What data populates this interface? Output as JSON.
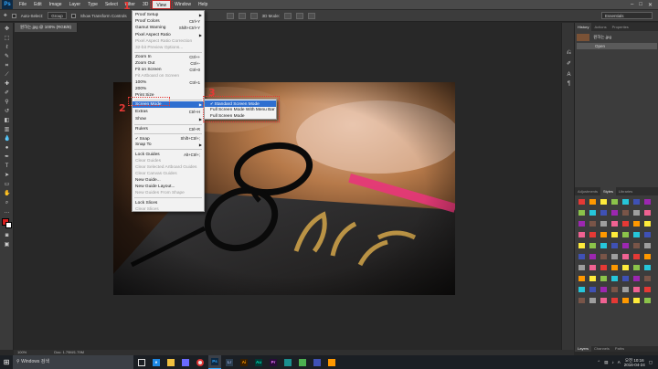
{
  "menubar": {
    "logo": "Ps",
    "items": [
      "File",
      "Edit",
      "Image",
      "Layer",
      "Type",
      "Select",
      "Filter",
      "3D",
      "View",
      "Window",
      "Help"
    ],
    "window_controls": [
      "–",
      "□",
      "✕"
    ]
  },
  "options_bar": {
    "auto_select_label": "Auto-Select:",
    "auto_select_value": "Group",
    "show_transform_label": "Show Transform Controls",
    "mode_3d": "3D Mode:",
    "workspace": "Essentials"
  },
  "document_tab": {
    "title": "원하는.jpg @ 100% (RGB/8)"
  },
  "view_menu": {
    "items": [
      {
        "label": "Proof Setup",
        "shortcut": "",
        "submenu": true,
        "disabled": false
      },
      {
        "label": "Proof Colors",
        "shortcut": "Ctrl+Y",
        "disabled": false
      },
      {
        "label": "Gamut Warning",
        "shortcut": "Shift+Ctrl+Y",
        "disabled": false
      },
      {
        "label": "Pixel Aspect Ratio",
        "shortcut": "",
        "submenu": true,
        "disabled": false
      },
      {
        "label": "Pixel Aspect Ratio Correction",
        "shortcut": "",
        "disabled": true
      },
      {
        "label": "32-bit Preview Options...",
        "shortcut": "",
        "disabled": true
      },
      {
        "label": "Zoom In",
        "shortcut": "Ctrl++",
        "disabled": false
      },
      {
        "label": "Zoom Out",
        "shortcut": "Ctrl+-",
        "disabled": false
      },
      {
        "label": "Fit on Screen",
        "shortcut": "Ctrl+0",
        "disabled": false
      },
      {
        "label": "Fit Artboard on Screen",
        "shortcut": "",
        "disabled": true
      },
      {
        "label": "100%",
        "shortcut": "Ctrl+1",
        "disabled": false
      },
      {
        "label": "200%",
        "shortcut": "",
        "disabled": false
      },
      {
        "label": "Print Size",
        "shortcut": "",
        "disabled": false
      },
      {
        "label": "Screen Mode",
        "shortcut": "",
        "submenu": true,
        "disabled": false,
        "highlighted": true
      },
      {
        "label": "Extras",
        "shortcut": "Ctrl+H",
        "disabled": false
      },
      {
        "label": "Show",
        "shortcut": "",
        "submenu": true,
        "disabled": false
      },
      {
        "label": "Rulers",
        "shortcut": "Ctrl+R",
        "disabled": false
      },
      {
        "label": "Snap",
        "shortcut": "Shift+Ctrl+;",
        "checked": true,
        "disabled": false
      },
      {
        "label": "Snap To",
        "shortcut": "",
        "submenu": true,
        "disabled": false
      },
      {
        "label": "Lock Guides",
        "shortcut": "Alt+Ctrl+;",
        "disabled": false
      },
      {
        "label": "Clear Guides",
        "shortcut": "",
        "disabled": true
      },
      {
        "label": "Clear Selected Artboard Guides",
        "shortcut": "",
        "disabled": true
      },
      {
        "label": "Clear Canvas Guides",
        "shortcut": "",
        "disabled": true
      },
      {
        "label": "New Guide...",
        "shortcut": "",
        "disabled": false
      },
      {
        "label": "New Guide Layout...",
        "shortcut": "",
        "disabled": false
      },
      {
        "label": "New Guides From Shape",
        "shortcut": "",
        "disabled": true
      },
      {
        "label": "Lock Slices",
        "shortcut": "",
        "disabled": false
      },
      {
        "label": "Clear Slices",
        "shortcut": "",
        "disabled": true
      }
    ]
  },
  "screen_mode_submenu": {
    "items": [
      {
        "label": "Standard Screen Mode",
        "checked": true,
        "highlighted": true
      },
      {
        "label": "Full Screen Mode With Menu Bar"
      },
      {
        "label": "Full Screen Mode"
      }
    ]
  },
  "step_markers": [
    "1",
    "2",
    "3"
  ],
  "right_panel": {
    "top_tabs": [
      "History",
      "Actions",
      "Properties"
    ],
    "history_file": "원하는.jpg",
    "history_step": "Open",
    "mid_tabs": [
      "Adjustments",
      "Styles",
      "Libraries"
    ],
    "bottom_tabs": [
      "Layers",
      "Channels",
      "Paths"
    ]
  },
  "status_bar": {
    "zoom": "100%",
    "doc_size": "Doc: 1.79M/1.79M"
  },
  "taskbar": {
    "search_placeholder": "Windows 검색",
    "clock_time": "오전 10:16",
    "clock_date": "2016-04-24"
  },
  "colors": {
    "accent_highlight": "#2f6fd0",
    "marker_red": "#e53935",
    "foreground_swatch": "#d71f1f"
  }
}
